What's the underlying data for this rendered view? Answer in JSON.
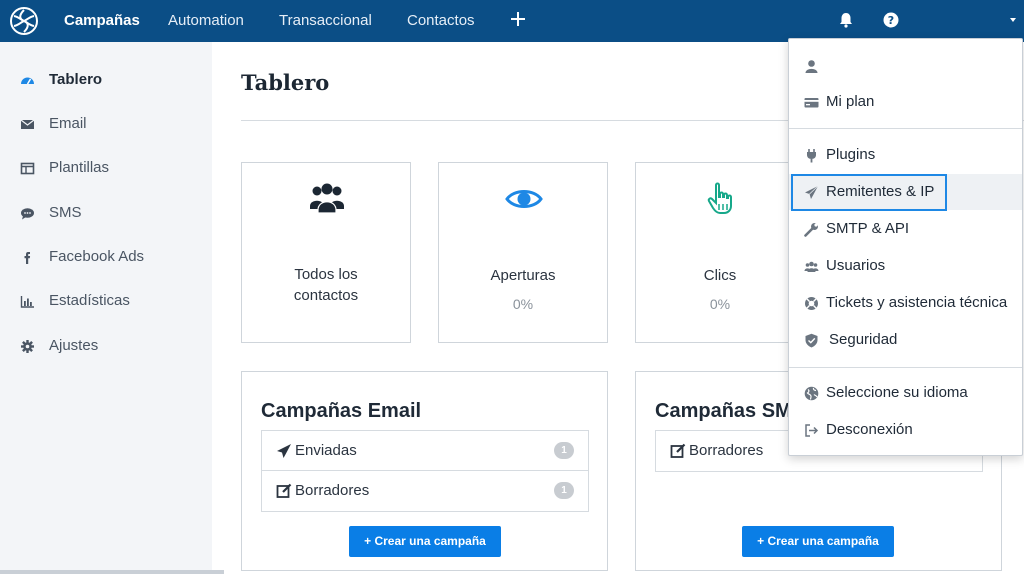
{
  "topnav": {
    "items": [
      {
        "label": "Campañas",
        "active": true
      },
      {
        "label": "Automation"
      },
      {
        "label": "Transaccional"
      },
      {
        "label": "Contactos"
      }
    ],
    "add_icon": "plus-icon",
    "notifications_icon": "bell-icon",
    "help_icon": "help-circle-icon",
    "brand_color": "#0b4e86"
  },
  "sidebar": {
    "items": [
      {
        "label": "Tablero",
        "icon": "dashboard-icon",
        "active": true
      },
      {
        "label": "Email",
        "icon": "envelope-icon"
      },
      {
        "label": "Plantillas",
        "icon": "template-icon"
      },
      {
        "label": "SMS",
        "icon": "chat-bubble-icon"
      },
      {
        "label": "Facebook Ads",
        "icon": "facebook-icon"
      },
      {
        "label": "Estadísticas",
        "icon": "bar-chart-icon"
      },
      {
        "label": "Ajustes",
        "icon": "gear-icon"
      }
    ]
  },
  "main": {
    "title": "Tablero",
    "stats": [
      {
        "label_line1": "Todos los",
        "label_line2": "contactos",
        "icon": "users-icon"
      },
      {
        "label": "Aperturas",
        "value": "0%",
        "icon": "eye-icon"
      },
      {
        "label": "Clics",
        "value": "0%",
        "icon": "pointer-hand-icon"
      }
    ],
    "panels": [
      {
        "title": "Campañas Email",
        "rows": [
          {
            "label": "Enviadas",
            "count": "1",
            "icon": "paper-plane-icon"
          },
          {
            "label": "Borradores",
            "count": "1",
            "icon": "edit-icon"
          }
        ],
        "button": "+ Crear una campaña"
      },
      {
        "title": "Campañas SMS",
        "rows": [
          {
            "label": "Borradores",
            "icon": "edit-icon"
          }
        ],
        "button": "+ Crear una campaña"
      }
    ],
    "accent_color": "#0a7ee6"
  },
  "account_menu": {
    "items": [
      {
        "label": "",
        "icon": "user-icon"
      },
      {
        "label": "Mi plan",
        "icon": "credit-card-icon"
      },
      {
        "label": "Plugins",
        "icon": "plug-icon"
      },
      {
        "label": "Remitentes & IP",
        "icon": "paper-plane-icon",
        "highlighted": true
      },
      {
        "label": "SMTP & API",
        "icon": "wrench-icon"
      },
      {
        "label": "Usuarios",
        "icon": "users-icon"
      },
      {
        "label": "Tickets y asistencia técnica",
        "icon": "lifebuoy-icon"
      },
      {
        "label": "Seguridad",
        "icon": "shield-icon"
      },
      {
        "label": "Seleccione su idioma",
        "icon": "globe-icon"
      },
      {
        "label": "Desconexión",
        "icon": "sign-out-icon"
      }
    ],
    "highlight_color": "#1e88e5"
  }
}
